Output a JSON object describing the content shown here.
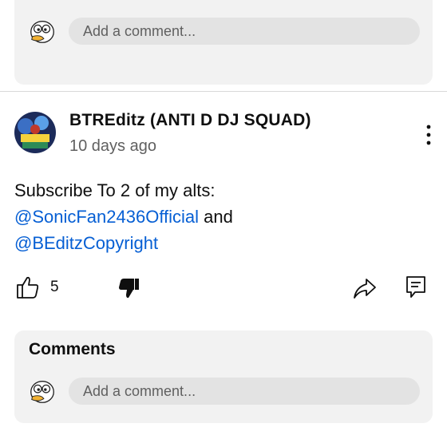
{
  "top_composer": {
    "placeholder": "Add a comment..."
  },
  "comment": {
    "author": "BTREditz (ANTI D DJ SQUAD)",
    "time": "10 days ago",
    "text_before": "Subscribe To 2 of my alts:",
    "mention1": "@SonicFan2436Official",
    "and_text": " and",
    "mention2": "@BEditzCopyright",
    "like_count": "5"
  },
  "comments_panel": {
    "title": "Comments",
    "placeholder": "Add a comment..."
  },
  "icons": [
    "duck-avatar-icon",
    "thumb-up-icon",
    "thumb-down-icon",
    "share-icon",
    "reply-icon",
    "more-vertical-icon"
  ],
  "colors": {
    "link": "#065fd4",
    "card_bg": "#f2f2f2",
    "pill_bg": "#e3e3e3"
  }
}
